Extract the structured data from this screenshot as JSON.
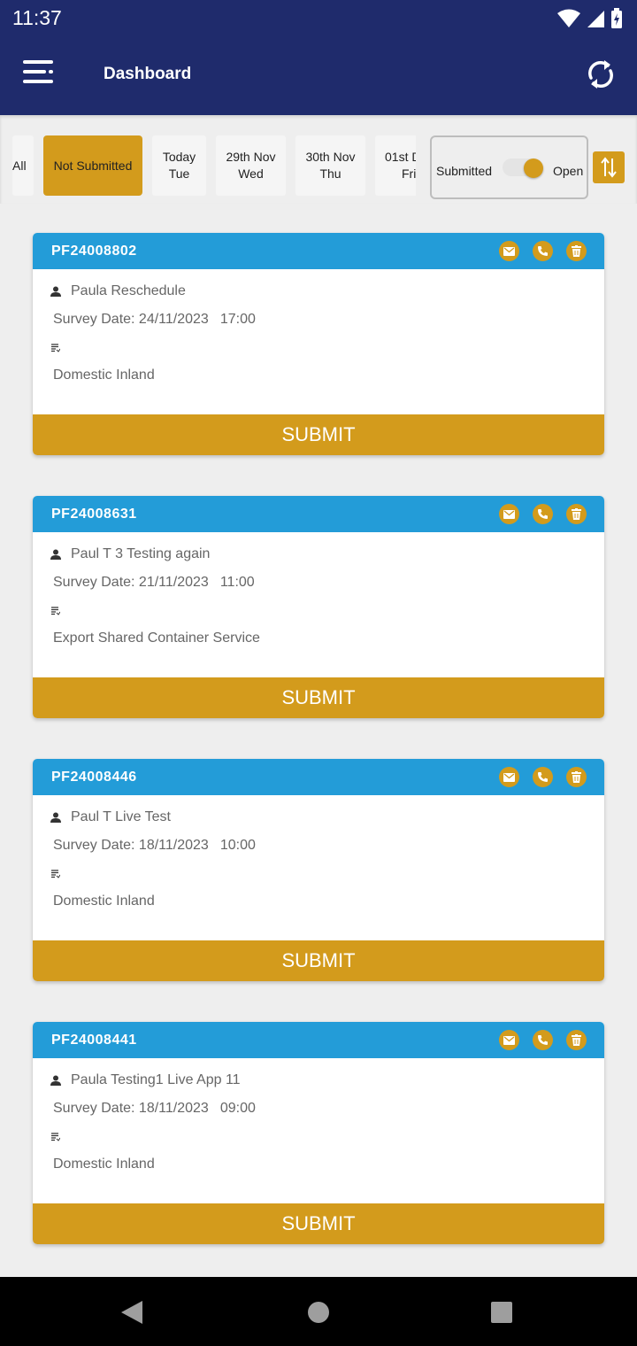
{
  "status_bar": {
    "time": "11:37"
  },
  "app_bar": {
    "title": "Dashboard"
  },
  "filters": {
    "chips": [
      {
        "label": "All"
      },
      {
        "label": "Not Submitted"
      },
      {
        "line1": "Today",
        "line2": "Tue"
      },
      {
        "line1": "29th Nov",
        "line2": "Wed"
      },
      {
        "line1": "30th Nov",
        "line2": "Thu"
      },
      {
        "line1": "01st D",
        "line2": "Fri"
      }
    ],
    "active_chip": "Not Submitted",
    "toggle": {
      "left_label": "Submitted",
      "right_label": "Open",
      "state": "Open"
    }
  },
  "cards": [
    {
      "ref": "PF24008802",
      "name": "Paula Reschedule",
      "date": "Survey Date: 24/11/2023",
      "time": "17:00",
      "service": "Domestic Inland",
      "submit": "SUBMIT"
    },
    {
      "ref": "PF24008631",
      "name": "Paul T 3 Testing again",
      "date": "Survey Date: 21/11/2023",
      "time": "11:00",
      "service": "Export Shared Container Service",
      "submit": "SUBMIT"
    },
    {
      "ref": "PF24008446",
      "name": "Paul T Live Test",
      "date": "Survey Date: 18/11/2023",
      "time": "10:00",
      "service": "Domestic Inland",
      "submit": "SUBMIT"
    },
    {
      "ref": "PF24008441",
      "name": "Paula Testing1 Live App 11",
      "date": "Survey Date: 18/11/2023",
      "time": "09:00",
      "service": "Domestic Inland",
      "submit": "SUBMIT"
    }
  ],
  "icons": {
    "menu": "menu-icon",
    "sync": "sync-icon",
    "sort": "sort-icon",
    "email": "email-icon",
    "phone": "phone-icon",
    "delete": "delete-icon",
    "person": "person-icon",
    "notes": "notes-icon"
  },
  "colors": {
    "primary": "#1f2b6c",
    "accent": "#d39b1c",
    "card_header": "#239cd8"
  }
}
